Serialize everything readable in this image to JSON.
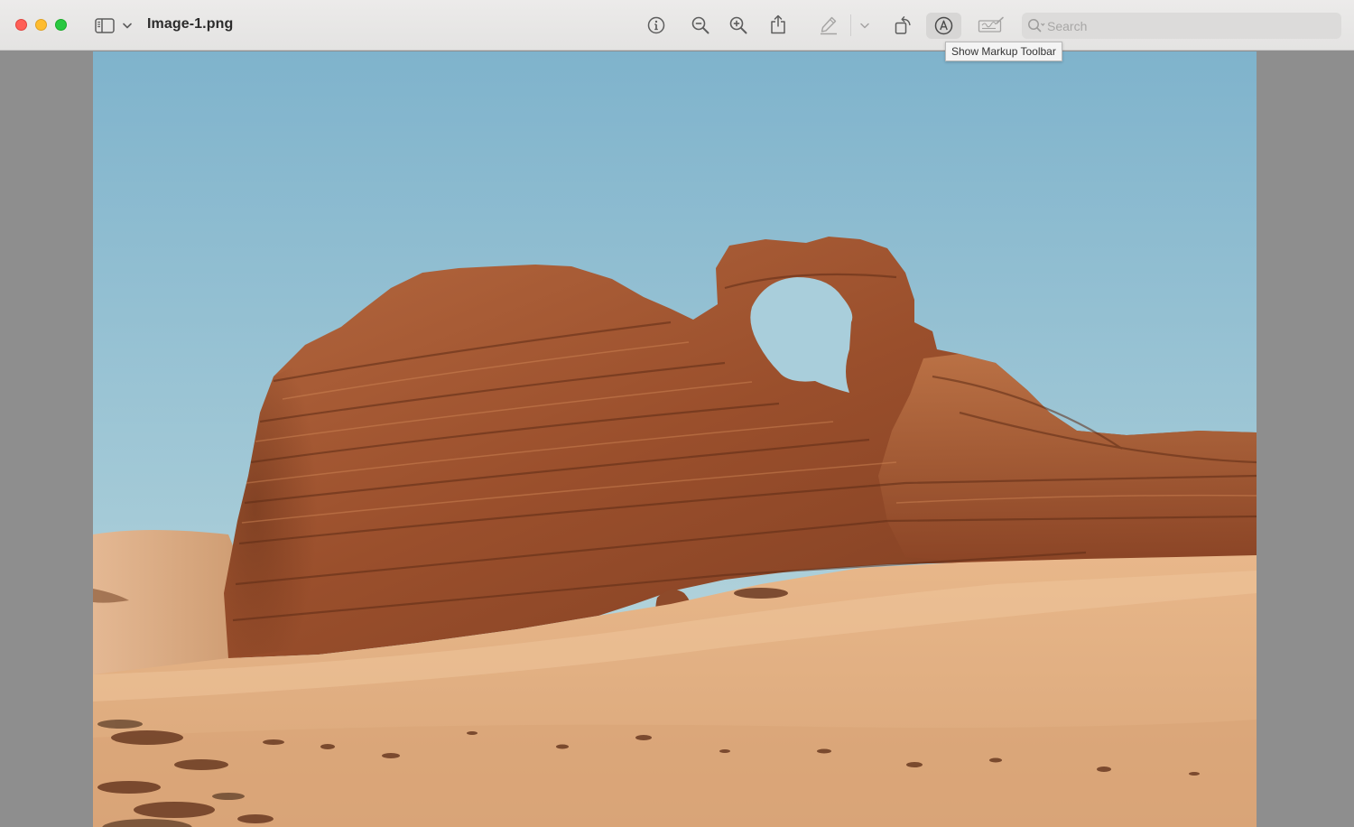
{
  "window": {
    "title": "Image-1.png"
  },
  "toolbar": {
    "buttons": [
      {
        "name": "sidebar-toggle",
        "icon": "sidebar-icon"
      },
      {
        "name": "sidebar-menu",
        "icon": "chevron-down-icon"
      },
      {
        "name": "info",
        "icon": "info-icon"
      },
      {
        "name": "zoom-out",
        "icon": "zoom-out-icon"
      },
      {
        "name": "zoom-in",
        "icon": "zoom-in-icon"
      },
      {
        "name": "share",
        "icon": "share-icon"
      },
      {
        "name": "highlight",
        "icon": "pen-icon"
      },
      {
        "name": "highlight-menu",
        "icon": "chevron-down-icon"
      },
      {
        "name": "rotate",
        "icon": "rotate-icon"
      },
      {
        "name": "markup",
        "icon": "markup-icon"
      },
      {
        "name": "signature",
        "icon": "signature-icon"
      }
    ],
    "tooltip": "Show Markup Toolbar"
  },
  "search": {
    "placeholder": "Search",
    "value": ""
  },
  "colors": {
    "titlebar": "#e7e6e5",
    "background": "#8e8e8e",
    "sky_top": "#7fb3cc",
    "sky_bottom": "#c2dde2",
    "rock": "#a55a34",
    "sand": "#e3b284"
  }
}
